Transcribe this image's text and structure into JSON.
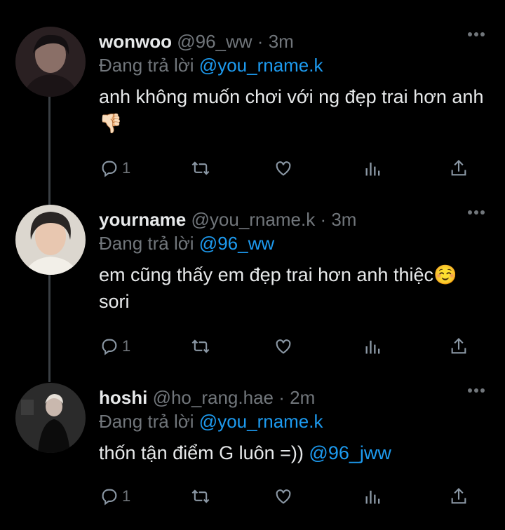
{
  "tweets": [
    {
      "name": "wonwoo",
      "handle": "@96_ww",
      "sep": "·",
      "time": "3m",
      "reply_prefix": "Đang trả lời",
      "reply_to": "@you_rname.k",
      "text": "anh không muốn chơi với ng đẹp trai hơn anh👎🏻",
      "mention": "",
      "reply_count": "1"
    },
    {
      "name": "yourname",
      "handle": "@you_rname.k",
      "sep": "·",
      "time": "3m",
      "reply_prefix": "Đang trả lời",
      "reply_to": "@96_ww",
      "text": "em cũng thấy em đẹp trai hơn anh thiệc☺️ sori",
      "mention": "",
      "reply_count": "1"
    },
    {
      "name": "hoshi",
      "handle": "@ho_rang.hae",
      "sep": "·",
      "time": "2m",
      "reply_prefix": "Đang trả lời",
      "reply_to": "@you_rname.k",
      "text": "thốn tận điểm G luôn =)) ",
      "mention": "@96_jww",
      "reply_count": "1"
    }
  ],
  "icons": [
    "more-icon",
    "reply-icon",
    "retweet-icon",
    "like-icon",
    "analytics-icon",
    "share-icon"
  ],
  "colors": {
    "background": "#000000",
    "text": "#e7e9ea",
    "muted": "#71767b",
    "link": "#1d9bf0"
  }
}
